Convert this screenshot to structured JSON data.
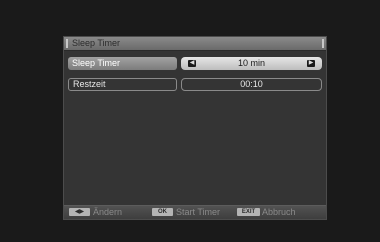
{
  "dialog": {
    "title": "Sleep Timer"
  },
  "rows": [
    {
      "label": "Sleep Timer",
      "value": "10 min",
      "left_arrow_icon": "arrow-left",
      "right_arrow_icon": "arrow-right"
    },
    {
      "label": "Restzeit",
      "value": "00:10"
    }
  ],
  "footer": {
    "nav_key": "◀▶",
    "nav_label": "Ändern",
    "ok_key": "OK",
    "ok_label": "Start Timer",
    "exit_key": "EXIT",
    "exit_label": "Abbruch"
  }
}
